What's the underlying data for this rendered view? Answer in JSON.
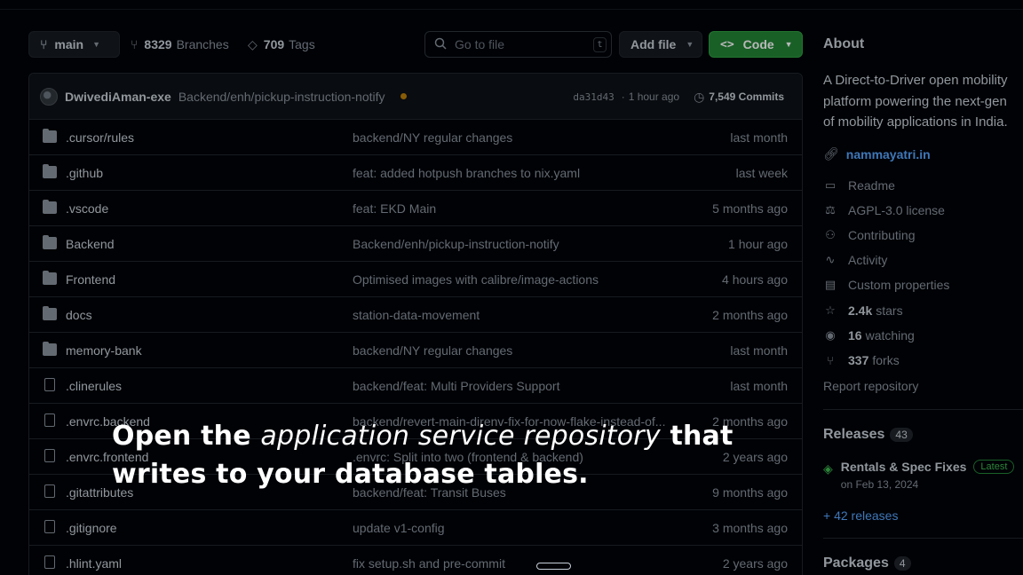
{
  "toolbar": {
    "branch": "main",
    "branches_count": "8329",
    "branches_label": "Branches",
    "tags_count": "709",
    "tags_label": "Tags",
    "search_placeholder": "Go to file",
    "search_key": "t",
    "add_file": "Add file",
    "code_button": "Code"
  },
  "commit": {
    "author": "DwivediAman-exe",
    "message": "Backend/enh/pickup-instruction-notify",
    "hash": "da31d43",
    "time": "1 hour ago",
    "commits": "7,549 Commits"
  },
  "files": [
    {
      "type": "folder",
      "name": ".cursor/rules",
      "message": "backend/NY regular changes",
      "time": "last month"
    },
    {
      "type": "folder",
      "name": ".github",
      "message": "feat: added hotpush branches to nix.yaml",
      "time": "last week"
    },
    {
      "type": "folder",
      "name": ".vscode",
      "message": "feat: EKD Main",
      "time": "5 months ago"
    },
    {
      "type": "folder",
      "name": "Backend",
      "message": "Backend/enh/pickup-instruction-notify",
      "time": "1 hour ago"
    },
    {
      "type": "folder",
      "name": "Frontend",
      "message": "Optimised images with calibre/image-actions",
      "time": "4 hours ago"
    },
    {
      "type": "folder",
      "name": "docs",
      "message": "station-data-movement",
      "time": "2 months ago"
    },
    {
      "type": "folder",
      "name": "memory-bank",
      "message": "backend/NY regular changes",
      "time": "last month"
    },
    {
      "type": "file",
      "name": ".clinerules",
      "message": "backend/feat: Multi Providers Support",
      "time": "last month"
    },
    {
      "type": "file",
      "name": ".envrc.backend",
      "message": "backend/revert-main-direnv-fix-for-now-flake-instead-of...",
      "time": "2 months ago"
    },
    {
      "type": "file",
      "name": ".envrc.frontend",
      "message": ".envrc: Split into two (frontend & backend)",
      "time": "2 years ago"
    },
    {
      "type": "file",
      "name": ".gitattributes",
      "message": "backend/feat: Transit Buses",
      "time": "9 months ago"
    },
    {
      "type": "file",
      "name": ".gitignore",
      "message": "update v1-config",
      "time": "3 months ago"
    },
    {
      "type": "file",
      "name": ".hlint.yaml",
      "message": "fix setup.sh and pre-commit",
      "time": "2 years ago"
    }
  ],
  "about": {
    "title": "About",
    "description": "A Direct-to-Driver open mobility\nplatform powering the next-gen\nof mobility applications in India.",
    "website": "nammayatri.in",
    "items": [
      {
        "icon": "book-icon",
        "label": "Readme"
      },
      {
        "icon": "scale-icon",
        "label": "AGPL-3.0 license"
      },
      {
        "icon": "people-icon",
        "label": "Contributing"
      },
      {
        "icon": "pulse-icon",
        "label": "Activity"
      },
      {
        "icon": "note-icon",
        "label": "Custom properties"
      }
    ],
    "stars_value": "2.4k",
    "stars_label": "stars",
    "watching_value": "16",
    "watching_label": "watching",
    "forks_value": "337",
    "forks_label": "forks",
    "report": "Report repository"
  },
  "releases": {
    "title": "Releases",
    "count": "43",
    "latest_name": "Rentals & Spec Fixes",
    "latest_badge": "Latest",
    "latest_date": "on Feb 13, 2024",
    "more": "+ 42 releases"
  },
  "packages": {
    "title": "Packages",
    "count": "4"
  },
  "caption": {
    "part1": "Open the ",
    "emphasis": "application service repository",
    "part2": " that writes to your database tables."
  },
  "colors": {
    "accent_green": "#238636",
    "link_blue": "#58a6ff",
    "background": "#010409"
  }
}
